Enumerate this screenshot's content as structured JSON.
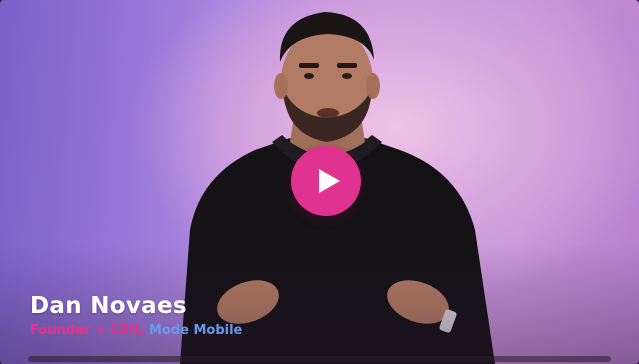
{
  "video": {
    "play_icon": "play-icon",
    "accent_color": "#e0338f"
  },
  "caption": {
    "name": "Dan Novaes",
    "title": "Founder + CEO,",
    "company": "Mode Mobile",
    "title_color": "#ea2f88",
    "company_color": "#6a98ee"
  }
}
